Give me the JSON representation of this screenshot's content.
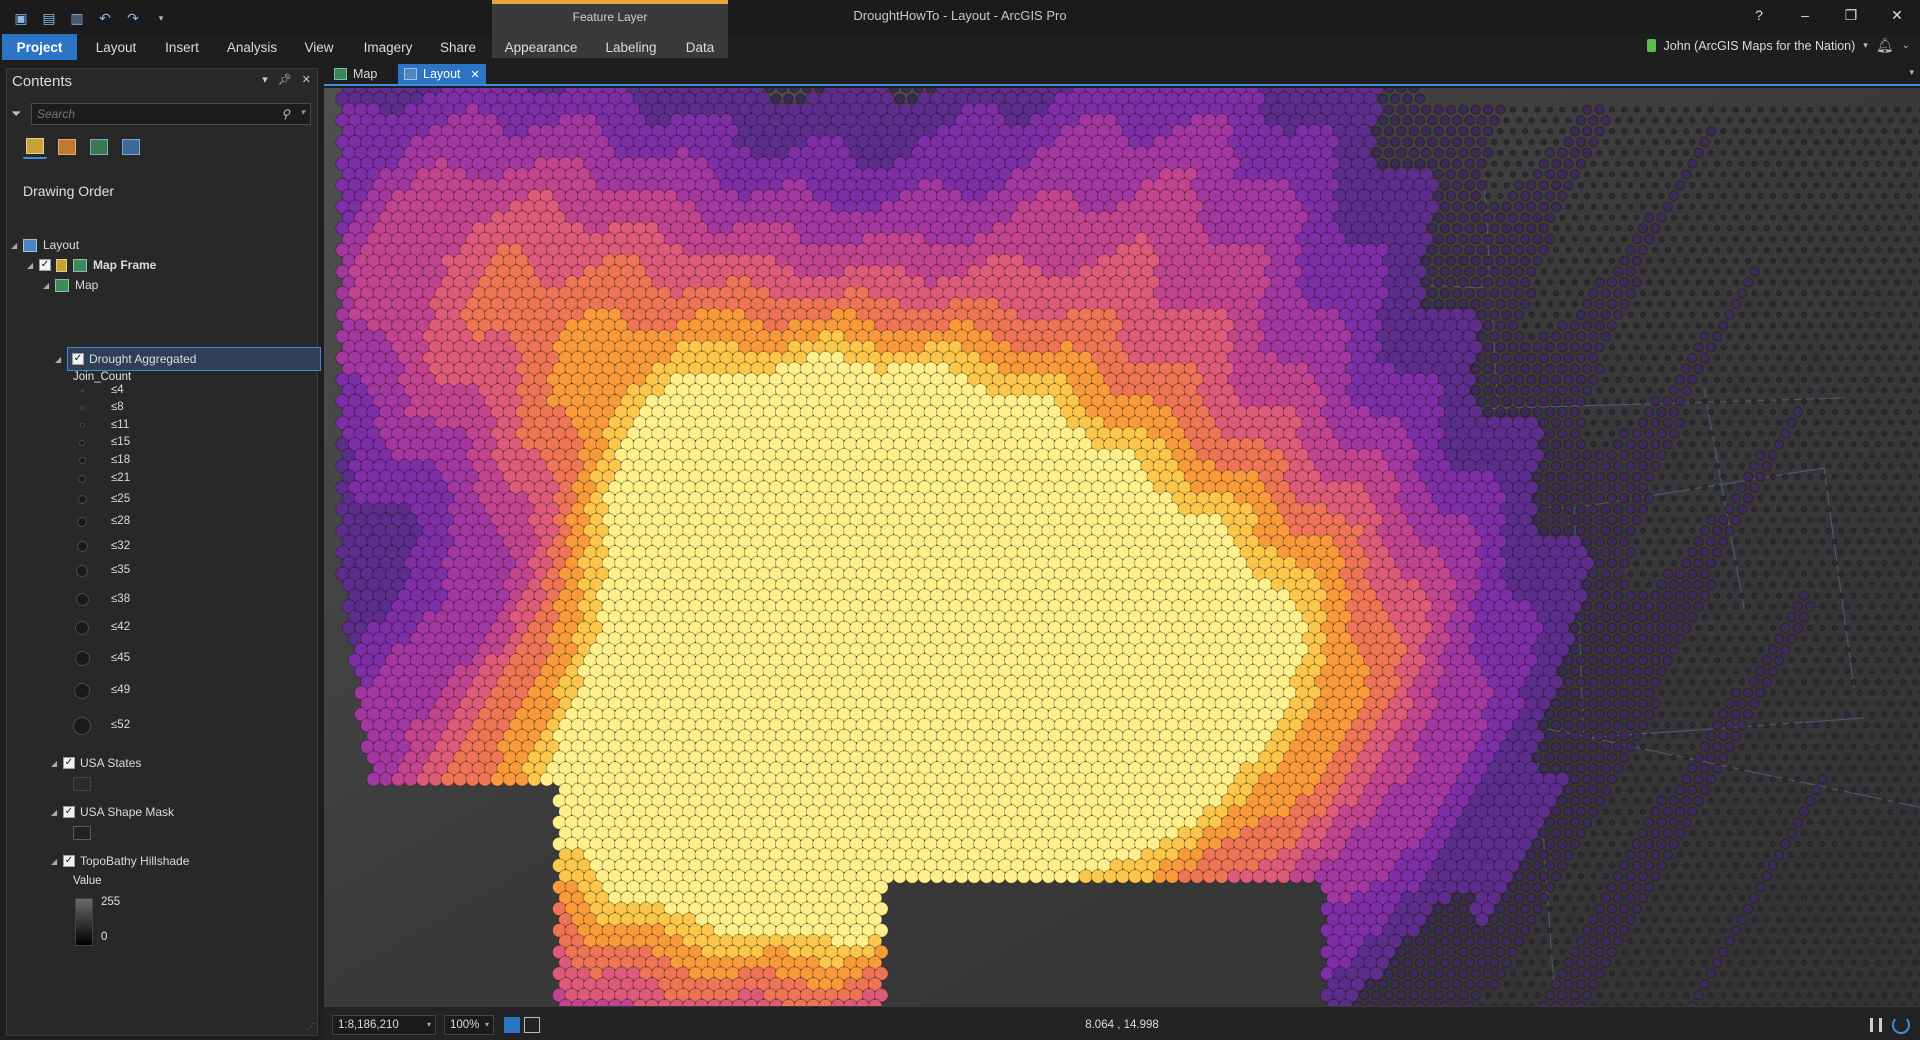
{
  "app": {
    "title": "DroughtHowTo - Layout - ArcGIS Pro",
    "contextual_group": "Feature Layer"
  },
  "ribbon": {
    "tabs": [
      "Project",
      "Layout",
      "Insert",
      "Analysis",
      "View",
      "Imagery",
      "Share",
      "Appearance",
      "Labeling",
      "Data"
    ],
    "active_tab": "Project",
    "user": "John (ArcGIS Maps for the Nation)"
  },
  "window_controls": {
    "help": "?",
    "minimize": "–",
    "restore": "❐",
    "close": "✕"
  },
  "contents": {
    "title": "Contents",
    "search_placeholder": "Search",
    "drawing_order": "Drawing Order",
    "tree": {
      "layout": "Layout",
      "map_frame": "Map Frame",
      "map": "Map",
      "drought": "Drought Aggregated",
      "field": "Join_Count",
      "classes": [
        "≤4",
        "≤8",
        "≤11",
        "≤15",
        "≤18",
        "≤21",
        "≤25",
        "≤28",
        "≤32",
        "≤35",
        "≤38",
        "≤42",
        "≤45",
        "≤49",
        "≤52"
      ],
      "usa_states": "USA States",
      "usa_mask": "USA Shape Mask",
      "hillshade": "TopoBathy Hillshade",
      "value_label": "Value",
      "value_high": "255",
      "value_low": "0"
    }
  },
  "doc_tabs": {
    "map": "Map",
    "layout": "Layout"
  },
  "status": {
    "scale": "1:8,186,210",
    "zoom": "100%",
    "coords": "8.064 , 14.998"
  },
  "palette": {
    "accent": "#2c74c6",
    "ctx": "#e8a33a",
    "drought_ramp": [
      "#2b2b33",
      "#3d2a58",
      "#5d2d8c",
      "#7e2fa6",
      "#a1379f",
      "#c2448f",
      "#dd5a78",
      "#ef7355",
      "#f89a3a",
      "#fbc64a",
      "#fdf08a"
    ]
  }
}
